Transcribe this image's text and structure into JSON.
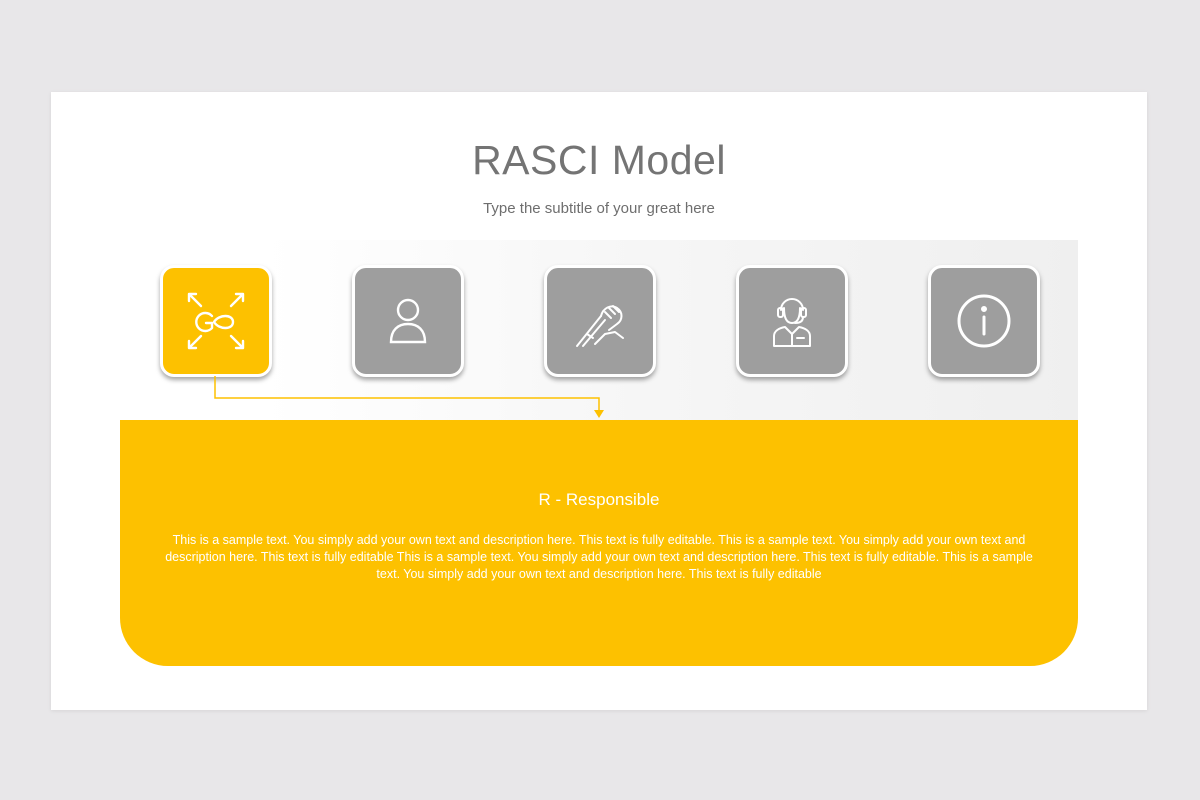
{
  "title": "RASCI Model",
  "subtitle": "Type the subtitle of your great here",
  "colors": {
    "accent": "#fdc100",
    "inactive_tile": "#9e9e9e"
  },
  "icons": [
    {
      "name": "go-arrows-icon",
      "active": true
    },
    {
      "name": "person-icon",
      "active": false
    },
    {
      "name": "handshake-icon",
      "active": false
    },
    {
      "name": "headset-agent-icon",
      "active": false
    },
    {
      "name": "info-icon",
      "active": false
    }
  ],
  "panel": {
    "heading": "R - Responsible",
    "body": "This is a sample text. You simply add your own text and description here. This text is fully editable. This is a sample text. You simply add your own text and description here. This text is fully editable This is a sample text. You simply add your own text and description here. This text is fully editable. This is a sample text. You simply add your own text and description here. This text is fully editable"
  }
}
